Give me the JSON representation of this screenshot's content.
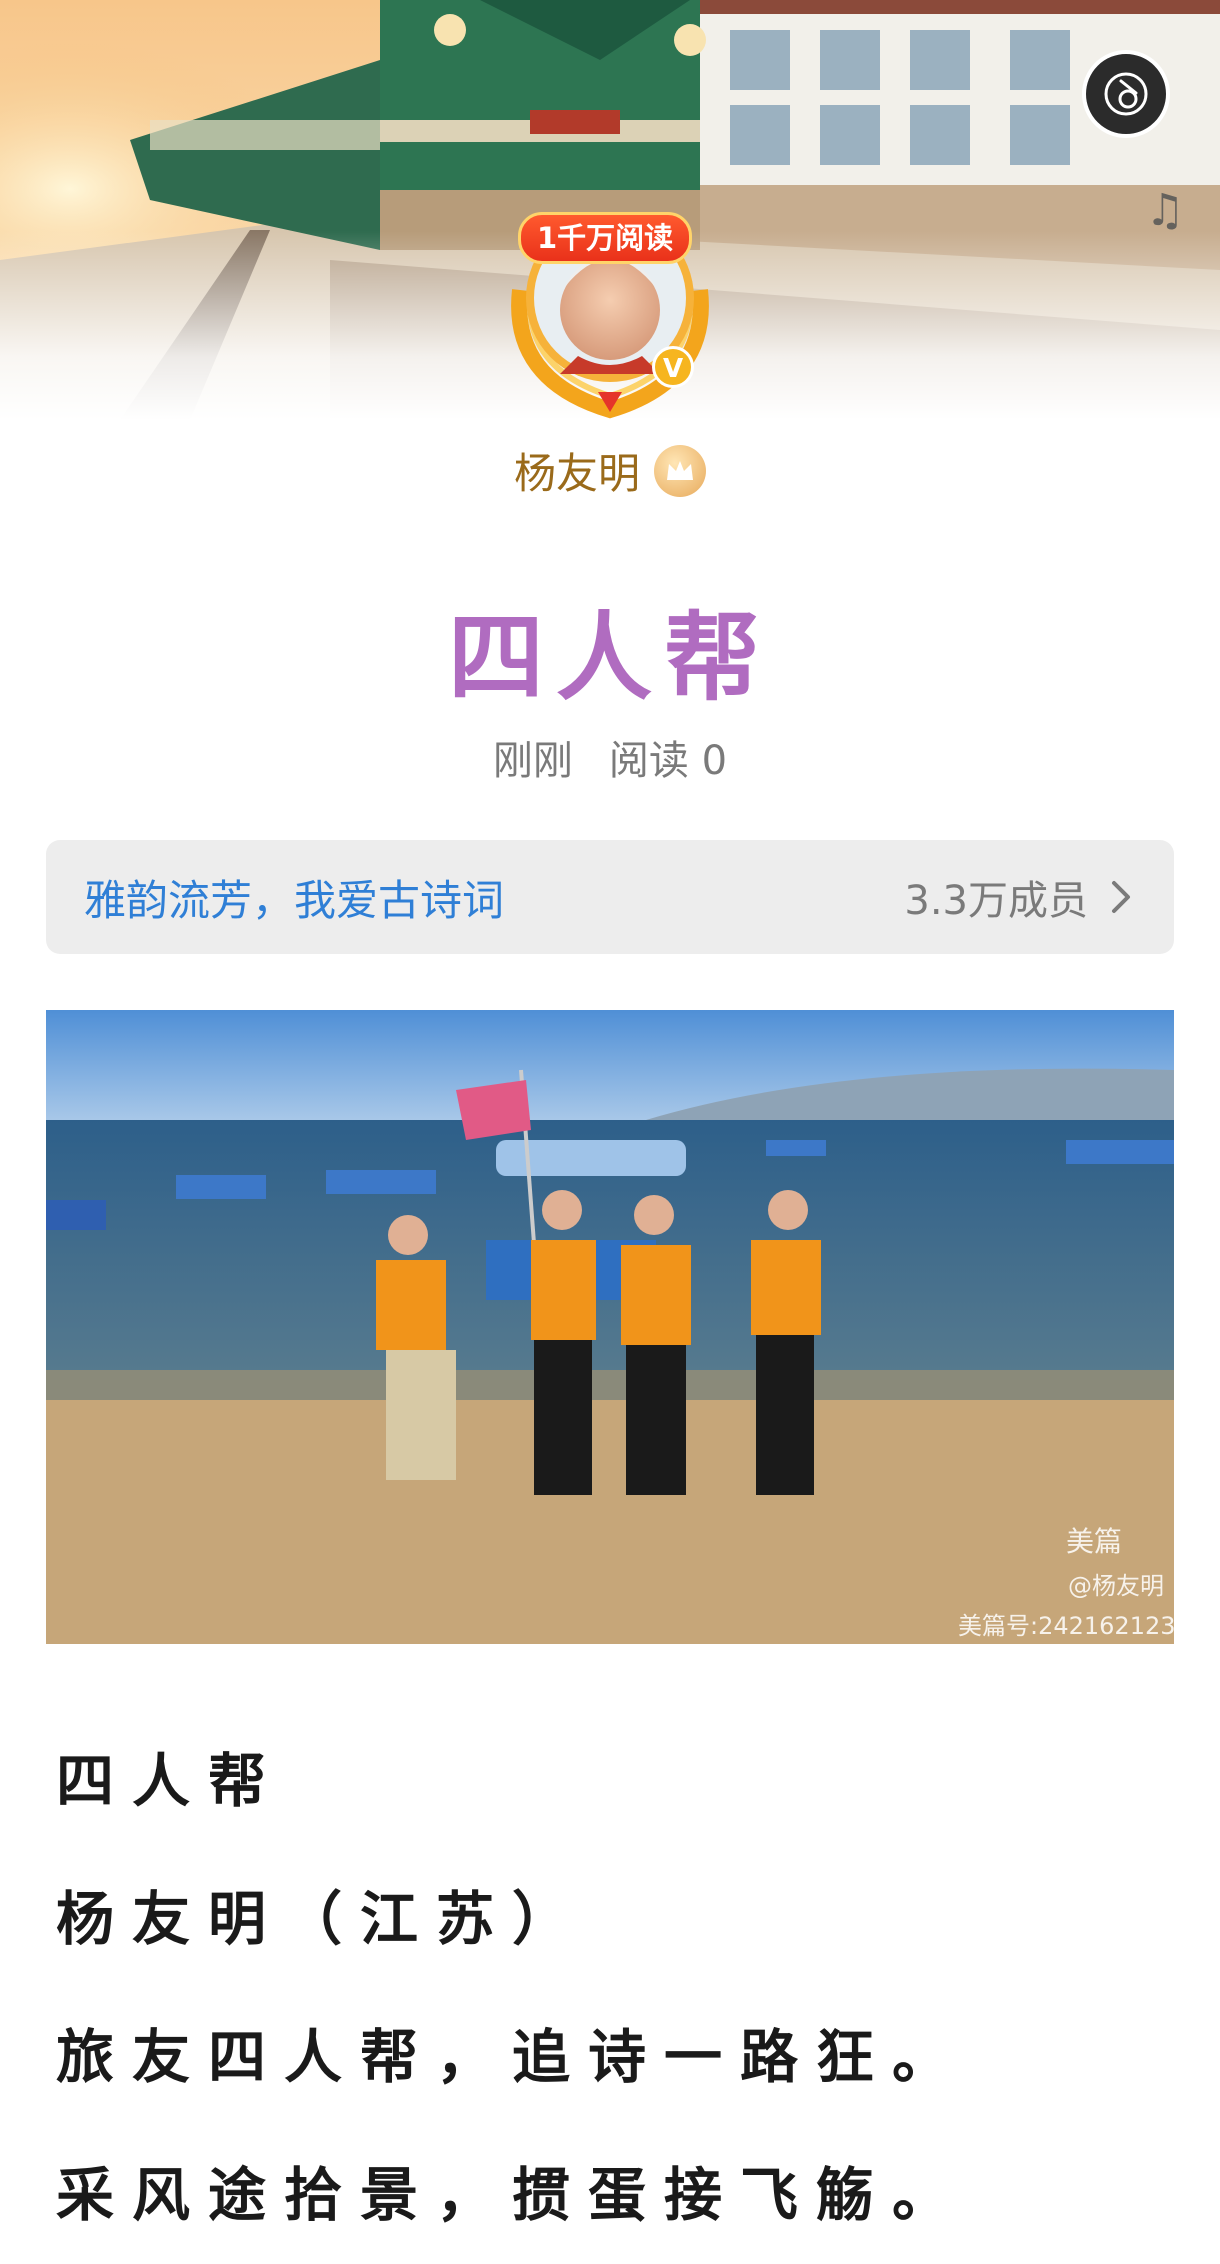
{
  "banner": {
    "music_icon": "music-disc-icon",
    "note_icon": "music-note-icon"
  },
  "author": {
    "read_badge": "1千万阅读",
    "verified_mark": "V",
    "name": "杨友明",
    "crown_icon": "crown-icon"
  },
  "article": {
    "title": "四人帮",
    "time": "刚刚",
    "reads": "阅读 0"
  },
  "community": {
    "name": "雅韵流芳，我爱古诗词",
    "members": "3.3万成员"
  },
  "photo": {
    "watermark_brand": "美篇",
    "watermark_user": "@杨友明",
    "watermark_id": "美篇号:242162123"
  },
  "poem": {
    "lines": [
      "四人帮",
      "杨友明（江苏）",
      "旅友四人帮，追诗一路狂。",
      "采风途拾景，掼蛋接飞觞。"
    ]
  },
  "colors": {
    "title": "#b06cc0",
    "author": "#9a6a1a",
    "link": "#2f7fd6"
  }
}
